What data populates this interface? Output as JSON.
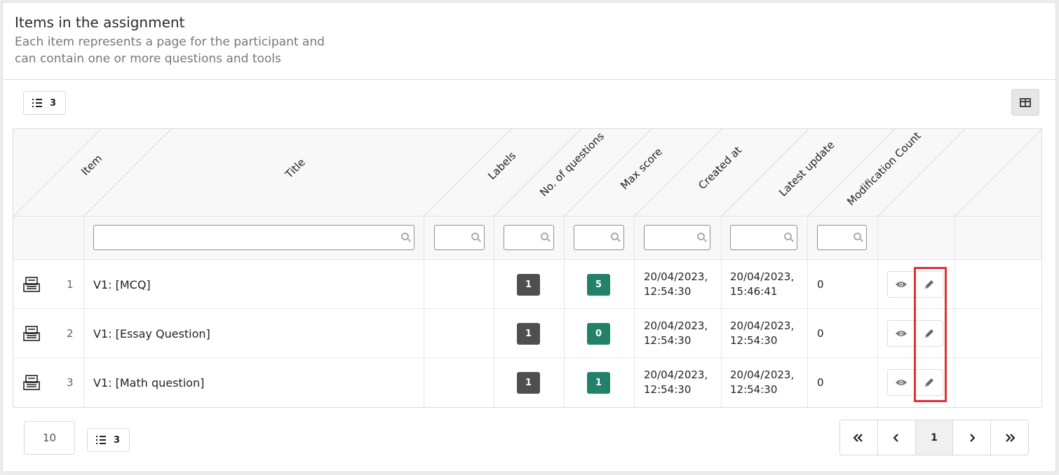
{
  "header": {
    "title": "Items in the assignment",
    "subtitle": "Each item represents a page for the participant and can contain one or more questions and tools"
  },
  "toolbar": {
    "count_top": "3",
    "count_bottom": "3"
  },
  "columns": [
    "Item",
    "Title",
    "Labels",
    "No. of questions",
    "Max score",
    "Created at",
    "Latest update",
    "Modification Count"
  ],
  "rows": [
    {
      "num": "1",
      "title": "V1: [MCQ]",
      "labels": "1",
      "questions": "5",
      "created_date": "20/04/2023,",
      "created_time": "12:54:30",
      "updated_date": "20/04/2023,",
      "updated_time": "15:46:41",
      "mods": "0"
    },
    {
      "num": "2",
      "title": "V1: [Essay Question]",
      "labels": "1",
      "questions": "0",
      "created_date": "20/04/2023,",
      "created_time": "12:54:30",
      "updated_date": "20/04/2023,",
      "updated_time": "12:54:30",
      "mods": "0"
    },
    {
      "num": "3",
      "title": "V1: [Math question]",
      "labels": "1",
      "questions": "1",
      "created_date": "20/04/2023,",
      "created_time": "12:54:30",
      "updated_date": "20/04/2023,",
      "updated_time": "12:54:30",
      "mods": "0"
    }
  ],
  "pagination": {
    "page_size": "10",
    "current_page": "1"
  },
  "colors": {
    "badge_gray": "#4f4f4f",
    "badge_green": "#23816a",
    "highlight": "#e0303a"
  },
  "icons": [
    "list-icon",
    "columns-icon",
    "search-icon",
    "document-icon",
    "eye-icon",
    "pencil-icon",
    "double-chevron-left-icon",
    "chevron-left-icon",
    "chevron-right-icon",
    "double-chevron-right-icon"
  ]
}
